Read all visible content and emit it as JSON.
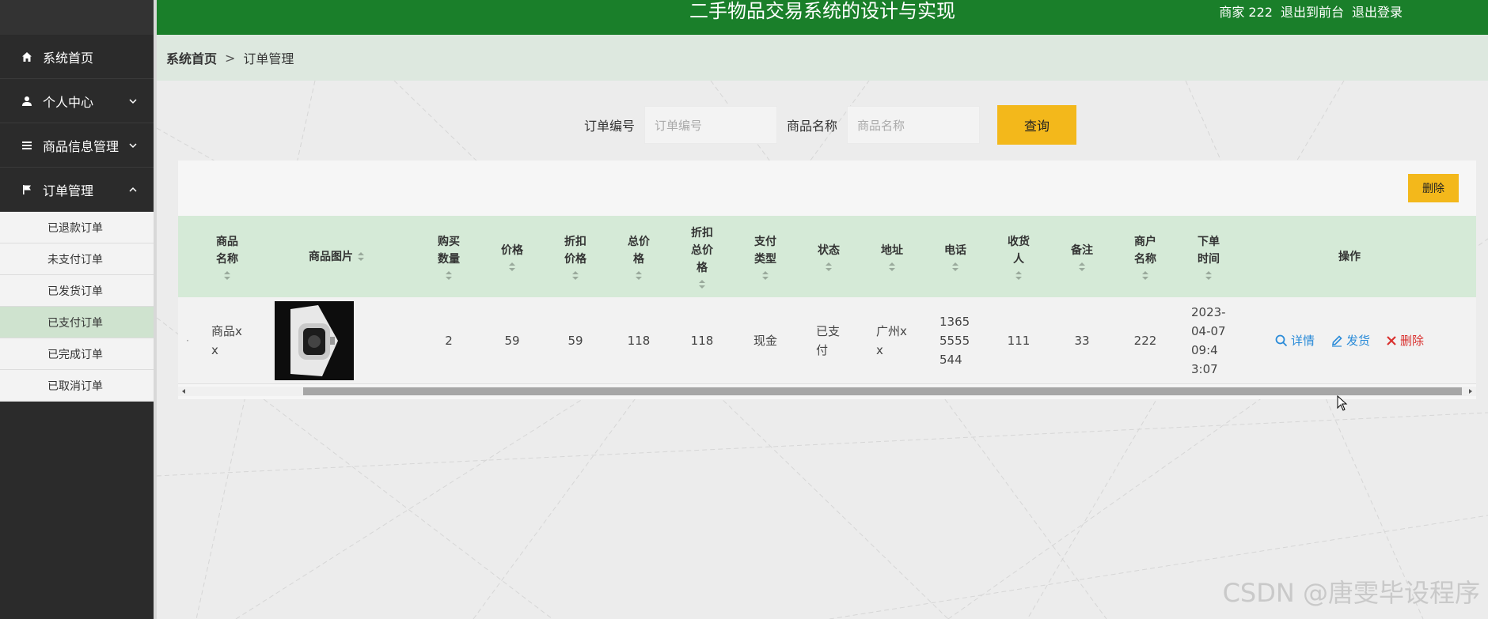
{
  "header": {
    "title": "二手物品交易系统的设计与实现",
    "user_label": "商家 222",
    "to_front": "退出到前台",
    "logout": "退出登录"
  },
  "sidebar": {
    "items": [
      {
        "label": "系统首页",
        "icon": "home-icon"
      },
      {
        "label": "个人中心",
        "icon": "user-icon"
      },
      {
        "label": "商品信息管理",
        "icon": "list-icon"
      },
      {
        "label": "订单管理",
        "icon": "flag-icon"
      }
    ],
    "sub_items": [
      "已退款订单",
      "未支付订单",
      "已发货订单",
      "已支付订单",
      "已完成订单",
      "已取消订单"
    ],
    "active_sub": "已支付订单"
  },
  "breadcrumb": {
    "home": "系统首页",
    "separator": ">",
    "current": "订单管理"
  },
  "search": {
    "order_label": "订单编号",
    "order_placeholder": "订单编号",
    "goods_label": "商品名称",
    "goods_placeholder": "商品名称",
    "query_button": "查询"
  },
  "table": {
    "delete_button": "删除",
    "columns": [
      "商品名称",
      "商品图片",
      "购买数量",
      "价格",
      "折扣价格",
      "总价格",
      "折扣总价格",
      "支付类型",
      "状态",
      "地址",
      "电话",
      "收货人",
      "备注",
      "商户名称",
      "下单时间",
      "操作"
    ],
    "row": {
      "goods_name": "商品xx",
      "quantity": "2",
      "price": "59",
      "discount_price": "59",
      "total_price": "118",
      "discount_total": "118",
      "pay_type": "现金",
      "status": "已支付",
      "address": "广州xx",
      "phone": "13655555544",
      "receiver": "111",
      "remark": "33",
      "merchant": "222",
      "order_time": "2023-04-07 09:43:07"
    },
    "actions": {
      "detail": "详情",
      "ship": "发货",
      "delete": "删除"
    }
  },
  "watermark": "CSDN @唐雯毕设程序",
  "colors": {
    "header_green": "#1a7f2a",
    "accent_yellow": "#f3b81b",
    "link_blue": "#2a8bd8",
    "danger_red": "#d9312f"
  }
}
